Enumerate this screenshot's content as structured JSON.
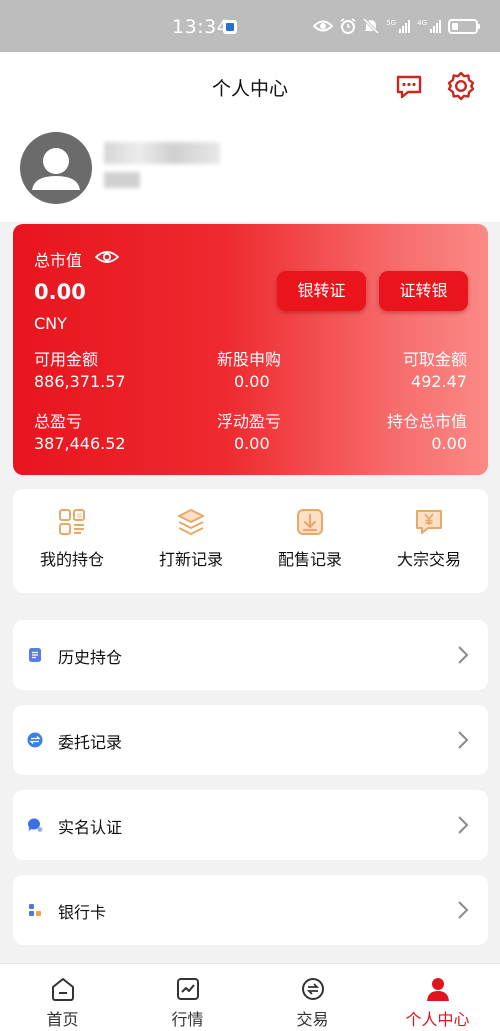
{
  "status_bar": {
    "time": "13:34",
    "net1": "5G",
    "net2": "4G"
  },
  "header": {
    "title": "个人中心"
  },
  "profile": {
    "name": "·",
    "id": "·"
  },
  "assets": {
    "total_label": "总市值",
    "total_value": "0.00",
    "currency": "CNY",
    "bank_to_securities": "银转证",
    "securities_to_bank": "证转银",
    "metrics": [
      {
        "label": "可用金额",
        "value": "886,371.57"
      },
      {
        "label": "新股申购",
        "value": "0.00"
      },
      {
        "label": "可取金额",
        "value": "492.47"
      },
      {
        "label": "总盈亏",
        "value": "387,446.52"
      },
      {
        "label": "浮动盈亏",
        "value": "0.00"
      },
      {
        "label": "持仓总市值",
        "value": "0.00"
      }
    ]
  },
  "shortcuts": [
    {
      "label": "我的持仓",
      "icon": "grid-icon"
    },
    {
      "label": "打新记录",
      "icon": "layers-icon"
    },
    {
      "label": "配售记录",
      "icon": "download-icon"
    },
    {
      "label": "大宗交易",
      "icon": "yuan-chat-icon"
    }
  ],
  "menu": [
    {
      "label": "历史持仓",
      "icon": "document-icon",
      "color": "#5b7be6"
    },
    {
      "label": "委托记录",
      "icon": "swap-icon",
      "color": "#3d7de8"
    },
    {
      "label": "实名认证",
      "icon": "chat-bubble-icon",
      "color": "#3c6ee6"
    },
    {
      "label": "银行卡",
      "icon": "tiles-icon",
      "color": "#4f77e3"
    }
  ],
  "tabs": [
    {
      "label": "首页",
      "icon": "home-icon"
    },
    {
      "label": "行情",
      "icon": "market-icon"
    },
    {
      "label": "交易",
      "icon": "trade-icon"
    },
    {
      "label": "个人中心",
      "icon": "person-icon"
    }
  ],
  "colors": {
    "accent": "#e0141c",
    "icon_orange": "#e9a86a",
    "menu_blue": "#4a73e4"
  }
}
